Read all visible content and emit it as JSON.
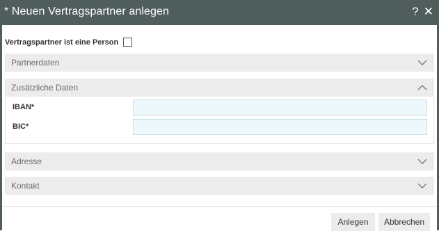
{
  "dialog": {
    "title": "* Neuen Vertragspartner anlegen",
    "help_label": "?",
    "close_label": "✕"
  },
  "person_checkbox": {
    "label": "Vertragspartner ist eine Person",
    "checked": false
  },
  "sections": {
    "partnerdaten": {
      "label": "Partnerdaten",
      "expanded": false
    },
    "zusaetzliche_daten": {
      "label": "Zusätzliche Daten",
      "expanded": true
    },
    "adresse": {
      "label": "Adresse",
      "expanded": false
    },
    "kontakt": {
      "label": "Kontakt",
      "expanded": false
    }
  },
  "fields": {
    "iban": {
      "label": "IBAN*",
      "value": ""
    },
    "bic": {
      "label": "BIC*",
      "value": ""
    }
  },
  "buttons": {
    "create": "Anlegen",
    "cancel": "Abbrechen"
  },
  "colors": {
    "titlebar": "#4f5d5c",
    "section_header": "#ececec",
    "input_background": "#ecf8fc"
  }
}
